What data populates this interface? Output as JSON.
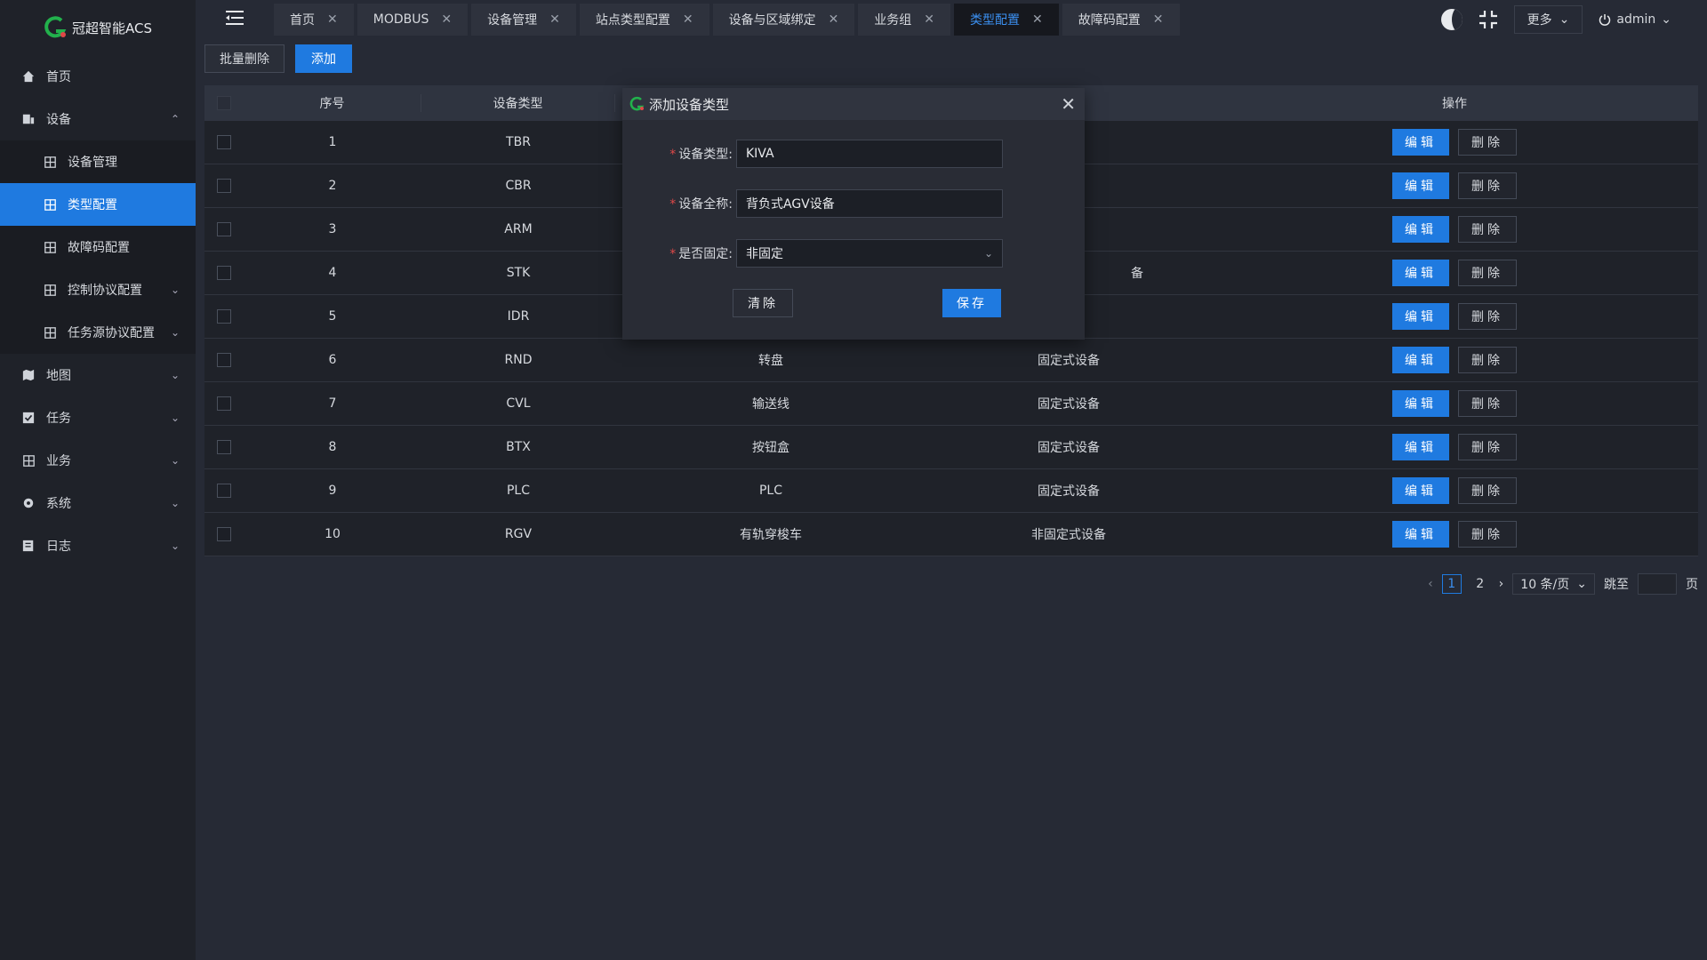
{
  "app": {
    "title": "冠超智能ACS",
    "brand_color": "#1f7ae0"
  },
  "sidebar": {
    "items": [
      {
        "label": "首页",
        "icon": "home-icon"
      },
      {
        "label": "设备",
        "icon": "device-icon",
        "expanded": true,
        "children": [
          {
            "label": "设备管理",
            "icon": "grid-icon"
          },
          {
            "label": "类型配置",
            "icon": "grid-icon",
            "active": true
          },
          {
            "label": "故障码配置",
            "icon": "grid-icon"
          },
          {
            "label": "控制协议配置",
            "icon": "grid-icon"
          },
          {
            "label": "任务源协议配置",
            "icon": "grid-icon"
          }
        ]
      },
      {
        "label": "地图",
        "icon": "map-icon"
      },
      {
        "label": "任务",
        "icon": "task-icon"
      },
      {
        "label": "业务",
        "icon": "grid-icon"
      },
      {
        "label": "系统",
        "icon": "gear-icon"
      },
      {
        "label": "日志",
        "icon": "log-icon"
      }
    ]
  },
  "tabs": [
    {
      "label": "首页"
    },
    {
      "label": "MODBUS"
    },
    {
      "label": "设备管理"
    },
    {
      "label": "站点类型配置"
    },
    {
      "label": "设备与区域绑定"
    },
    {
      "label": "业务组"
    },
    {
      "label": "类型配置",
      "active": true
    },
    {
      "label": "故障码配置"
    }
  ],
  "topbar": {
    "more_label": "更多",
    "user_label": "admin"
  },
  "actions": {
    "batch_delete": "批量删除",
    "add": "添加"
  },
  "table": {
    "headers": {
      "no": "序号",
      "type": "设备类型",
      "name": "",
      "fixed": "",
      "op": "操作"
    },
    "edit_label": "编辑",
    "delete_label": "删除",
    "rows": [
      {
        "no": "1",
        "type": "TBR",
        "name": "",
        "fixed": ""
      },
      {
        "no": "2",
        "type": "CBR",
        "name": "",
        "fixed": ""
      },
      {
        "no": "3",
        "type": "ARM",
        "name": "",
        "fixed": ""
      },
      {
        "no": "4",
        "type": "STK",
        "name": "",
        "fixed": "备"
      },
      {
        "no": "5",
        "type": "IDR",
        "name": "",
        "fixed": ""
      },
      {
        "no": "6",
        "type": "RND",
        "name": "转盘",
        "fixed": "固定式设备"
      },
      {
        "no": "7",
        "type": "CVL",
        "name": "输送线",
        "fixed": "固定式设备"
      },
      {
        "no": "8",
        "type": "BTX",
        "name": "按钮盒",
        "fixed": "固定式设备"
      },
      {
        "no": "9",
        "type": "PLC",
        "name": "PLC",
        "fixed": "固定式设备"
      },
      {
        "no": "10",
        "type": "RGV",
        "name": "有轨穿梭车",
        "fixed": "非固定式设备"
      }
    ]
  },
  "pager": {
    "pages": [
      "1",
      "2"
    ],
    "current": "1",
    "page_size": "10 条/页",
    "jump_label": "跳至",
    "page_suffix": "页"
  },
  "modal": {
    "title": "添加设备类型",
    "fields": [
      {
        "label": "设备类型:",
        "value": "KIVA"
      },
      {
        "label": "设备全称:",
        "value": "背负式AGV设备"
      },
      {
        "label": "是否固定:",
        "value": "非固定"
      }
    ],
    "clear_label": "清除",
    "save_label": "保存"
  }
}
